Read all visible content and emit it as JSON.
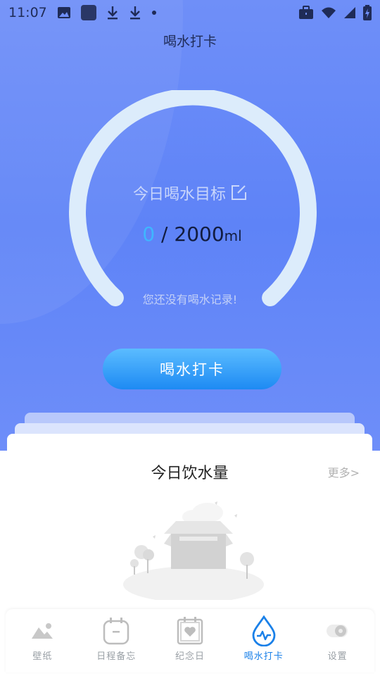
{
  "status_bar": {
    "time": "11:07"
  },
  "header": {
    "title": "喝水打卡"
  },
  "goal": {
    "label": "今日喝水目标",
    "current": "0",
    "separator": " / ",
    "target": "2000",
    "unit": "ml",
    "progress": 0,
    "no_record": "您还没有喝水记录!"
  },
  "checkin_button": {
    "label": "喝水打卡"
  },
  "intake_card": {
    "title": "今日饮水量",
    "more": "更多>"
  },
  "tabs": [
    {
      "label": "壁纸",
      "icon": "mountain-icon",
      "active": false
    },
    {
      "label": "日程备忘",
      "icon": "calendar-icon",
      "active": false
    },
    {
      "label": "纪念日",
      "icon": "heart-calendar-icon",
      "active": false
    },
    {
      "label": "喝水打卡",
      "icon": "water-drop-pulse-icon",
      "active": true
    },
    {
      "label": "设置",
      "icon": "gear-icon",
      "active": false
    }
  ],
  "colors": {
    "hero_bg": "#6a8af8",
    "ring": "#dcecfb",
    "accent": "#1a80e8",
    "current_value": "#3fb6ff"
  }
}
